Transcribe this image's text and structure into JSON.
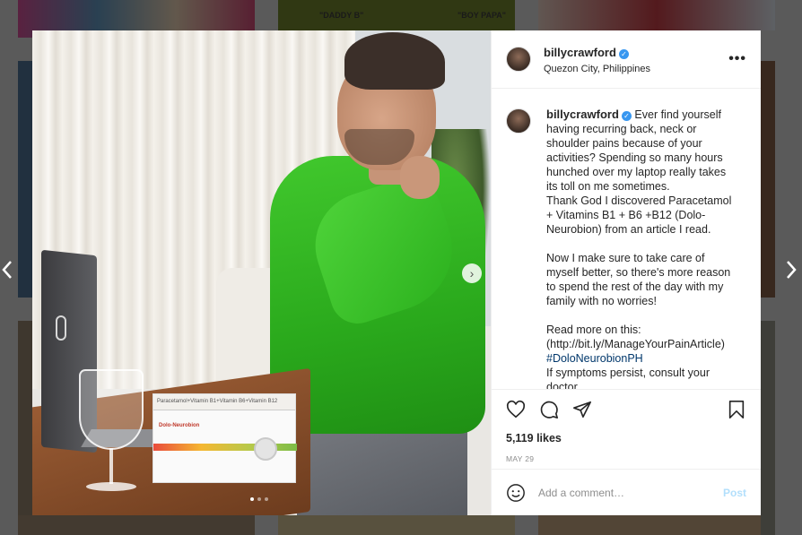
{
  "background": {
    "caption_left": "\"DADDY B\"",
    "caption_right": "\"BOY PAPA\""
  },
  "nav": {
    "prev_icon": "chevron-left-icon",
    "next_icon": "chevron-right-icon"
  },
  "photo": {
    "box_top_text": "Paracetamol+Vitamin B1+Vitamin B6+Vitamin B12",
    "box_brand": "Dolo-Neurobion",
    "slides": 3,
    "active_slide": 1
  },
  "post": {
    "username": "billycrawford",
    "verified": true,
    "location": "Quezon City, Philippines",
    "caption": {
      "p1": "Ever find yourself having recurring back, neck or shoulder pains because of your activities? Spending so many hours hunched over my laptop really takes its toll on me sometimes.",
      "p2": "Thank God I discovered Paracetamol + Vitamins B1 + B6 +B12 (Dolo-Neurobion) from an article I read.",
      "p3": "Now I make sure to take care of myself better, so there's more reason to spend the rest of the day with my family with no worries!",
      "p4": "Read more on this:",
      "p5": "(http://bit.ly/ManageYourPainArticle)",
      "hashtag": "#DoloNeurobionPH",
      "p6": "If symptoms persist, consult your doctor."
    },
    "likes": "5,119 likes",
    "date": "MAY 29",
    "comment_placeholder": "Add a comment…",
    "post_label": "Post",
    "colors": {
      "verified": "#3897f0",
      "post_disabled": "#b2dffc",
      "hashtag": "#00376b"
    }
  }
}
